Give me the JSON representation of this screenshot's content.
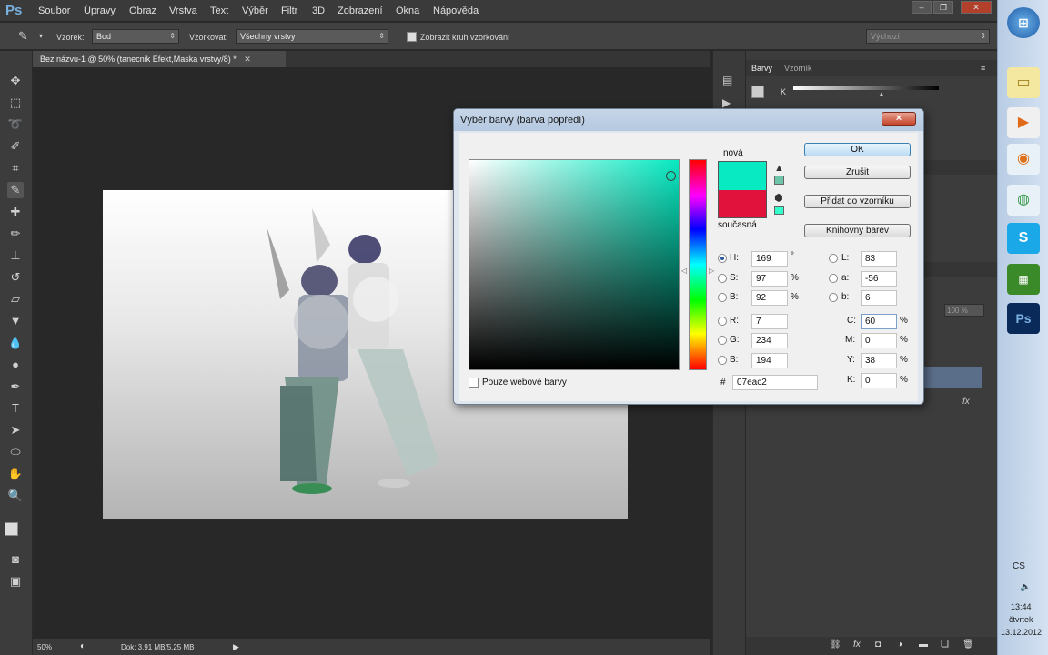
{
  "app": {
    "logo": "Ps"
  },
  "menu": [
    "Soubor",
    "Úpravy",
    "Obraz",
    "Vrstva",
    "Text",
    "Výběr",
    "Filtr",
    "3D",
    "Zobrazení",
    "Okna",
    "Nápověda"
  ],
  "options_bar": {
    "sample_label": "Vzorek:",
    "sample_value": "Bod",
    "sample_layers_label": "Vzorkovat:",
    "sample_layers_value": "Všechny vrstvy",
    "show_ring_label": "Zobrazit kruh vzorkování",
    "workspace_value": "Výchozí"
  },
  "document_tab": {
    "title": "Bez názvu-1 @ 50% (tanecnik Efekt,Maska vrstvy/8) *"
  },
  "status_bar": {
    "zoom": "50%",
    "doc_info": "Dok: 3,91 MB/5,25 MB"
  },
  "right_panel": {
    "tab_color": "Barvy",
    "tab_swatches": "Vzorník",
    "channel_label": "K",
    "opacity_label": "100 %"
  },
  "dialog": {
    "title": "Výběr barvy (barva popředí)",
    "close_label": "×",
    "label_new": "nová",
    "label_current": "současná",
    "new_color": "#07eac2",
    "current_color": "#e1123c",
    "buttons": {
      "ok": "OK",
      "cancel": "Zrušit",
      "add_swatch": "Přidat do vzorníku",
      "libraries": "Knihovny barev"
    },
    "fields": {
      "h": {
        "label": "H:",
        "value": "169",
        "unit": "°"
      },
      "s": {
        "label": "S:",
        "value": "97",
        "unit": "%"
      },
      "b": {
        "label": "B:",
        "value": "92",
        "unit": "%"
      },
      "r": {
        "label": "R:",
        "value": "7"
      },
      "g": {
        "label": "G:",
        "value": "234"
      },
      "bb": {
        "label": "B:",
        "value": "194"
      },
      "l": {
        "label": "L:",
        "value": "83"
      },
      "a": {
        "label": "a:",
        "value": "-56"
      },
      "lab_b": {
        "label": "b:",
        "value": "6"
      },
      "c": {
        "label": "C:",
        "value": "60",
        "unit": "%"
      },
      "m": {
        "label": "M:",
        "value": "0",
        "unit": "%"
      },
      "y": {
        "label": "Y:",
        "value": "38",
        "unit": "%"
      },
      "k": {
        "label": "K:",
        "value": "0",
        "unit": "%"
      },
      "hex_label": "#",
      "hex": "07eac2"
    },
    "web_only_label": "Pouze webové barvy"
  },
  "taskbar": {
    "lang": "CS",
    "time": "13:44",
    "day": "čtvrtek",
    "date": "13.12.2012"
  }
}
